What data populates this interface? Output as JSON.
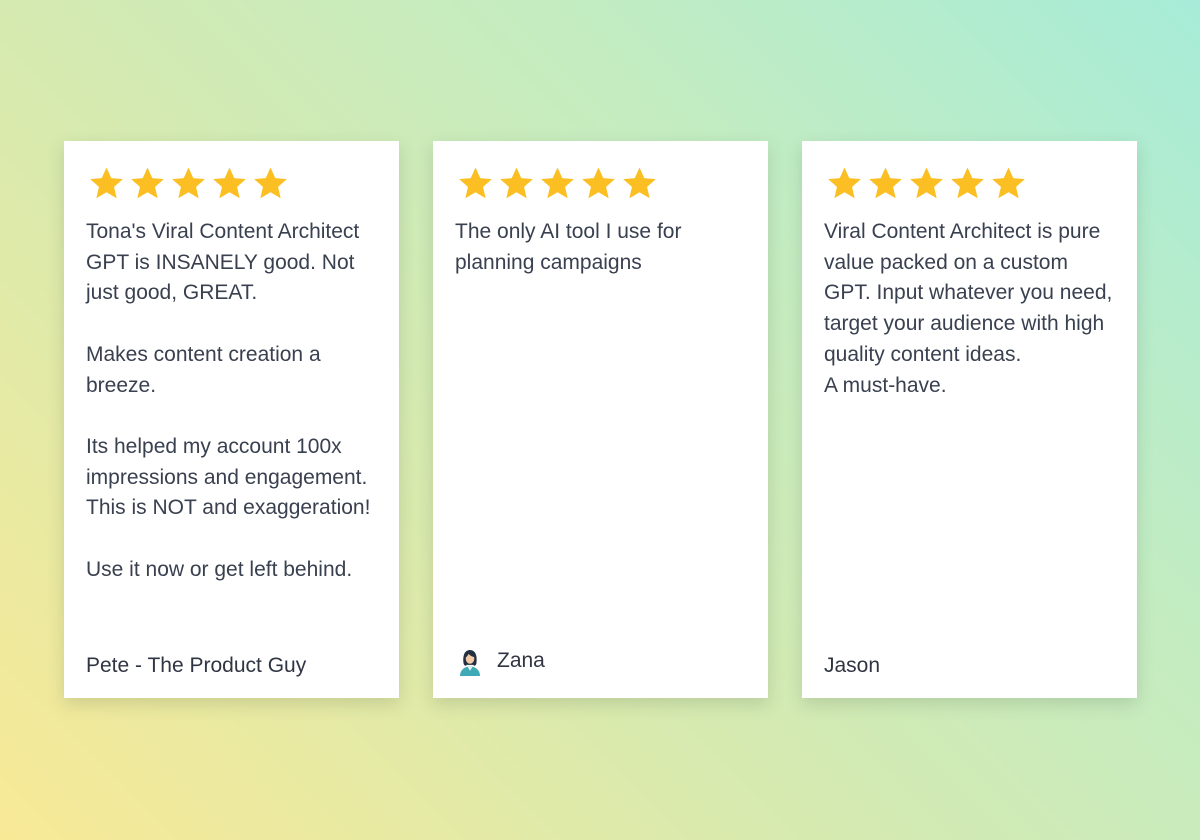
{
  "colors": {
    "star": "#fbbf24",
    "text": "#39404f",
    "card": "#ffffff"
  },
  "reviews": [
    {
      "rating": 5,
      "text": "Tona's Viral Content Architect GPT is INSANELY good. Not just good, GREAT.\n\nMakes content creation a breeze.\n\nIts helped my account 100x impressions and engagement. This is NOT and exaggeration!\n\nUse it now or get left behind.",
      "author": "Pete - The Product Guy"
    },
    {
      "rating": 5,
      "text": "The only AI tool I use for planning campaigns",
      "author": "Zana",
      "avatar_icon": "user-avatar-icon"
    },
    {
      "rating": 5,
      "text": "Viral Content Architect is pure value packed on a custom GPT. Input whatever you need, target your audience with high quality content ideas.\nA must-have.",
      "author": "Jason"
    }
  ]
}
